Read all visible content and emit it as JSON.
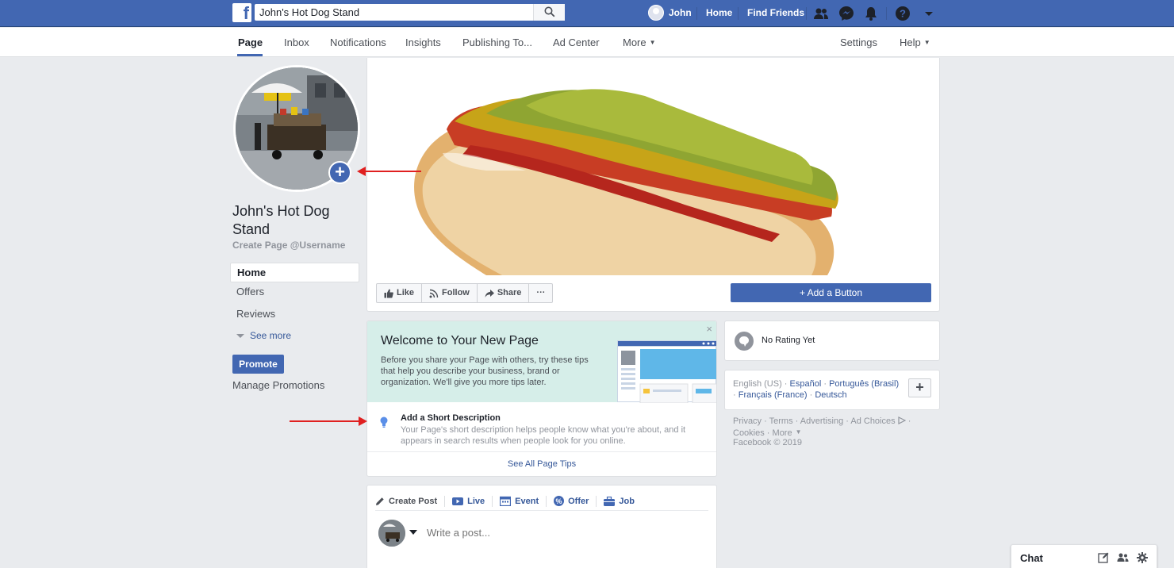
{
  "topbar": {
    "search_value": "John's Hot Dog Stand",
    "user_name": "John",
    "home_label": "Home",
    "find_friends_label": "Find Friends"
  },
  "page_nav": {
    "tabs": [
      {
        "label": "Page"
      },
      {
        "label": "Inbox"
      },
      {
        "label": "Notifications"
      },
      {
        "label": "Insights"
      },
      {
        "label": "Publishing To..."
      },
      {
        "label": "Ad Center"
      },
      {
        "label": "More"
      }
    ],
    "settings_label": "Settings",
    "help_label": "Help"
  },
  "left": {
    "page_name": "John's Hot Dog Stand",
    "username_link": "Create Page @Username",
    "nav": [
      {
        "label": "Home"
      },
      {
        "label": "Offers"
      },
      {
        "label": "Reviews"
      }
    ],
    "see_more": "See more",
    "promote": "Promote",
    "manage_promotions": "Manage Promotions"
  },
  "cover": {
    "actions": [
      {
        "label": "Like",
        "icon": "thumbs-up-icon"
      },
      {
        "label": "Follow",
        "icon": "rss-icon"
      },
      {
        "label": "Share",
        "icon": "share-arrow-icon"
      },
      {
        "label": "···",
        "icon": "more-dots-icon"
      }
    ],
    "add_button": "+ Add a Button"
  },
  "welcome": {
    "title": "Welcome to Your New Page",
    "text": "Before you share your Page with others, try these tips that help you describe your business, brand or organization. We'll give you more tips later.",
    "close": "×",
    "tip_title": "Add a Short Description",
    "tip_desc": "Your Page's short description helps people know what you're about, and it appears in search results when people look for you online.",
    "see_all": "See All Page Tips"
  },
  "composer": {
    "tabs": [
      {
        "label": "Create Post",
        "icon": "pencil-icon"
      },
      {
        "label": "Live",
        "icon": "live-video-icon"
      },
      {
        "label": "Event",
        "icon": "calendar-icon"
      },
      {
        "label": "Offer",
        "icon": "percent-tag-icon"
      },
      {
        "label": "Job",
        "icon": "briefcase-icon"
      }
    ],
    "placeholder": "Write a post..."
  },
  "right": {
    "rating": "No Rating Yet",
    "languages": {
      "current": "English (US)",
      "options": [
        "Español",
        "Português (Brasil)",
        "Français (France)",
        "Deutsch"
      ]
    },
    "footer_links": [
      "Privacy",
      "Terms",
      "Advertising",
      "Ad Choices",
      "Cookies",
      "More"
    ],
    "copyright": "Facebook © 2019"
  },
  "chat": {
    "label": "Chat"
  },
  "colors": {
    "brand": "#4267b2",
    "link": "#365899",
    "annotation_arrow": "#e02020",
    "welcome_bg": "#d6eee9"
  }
}
